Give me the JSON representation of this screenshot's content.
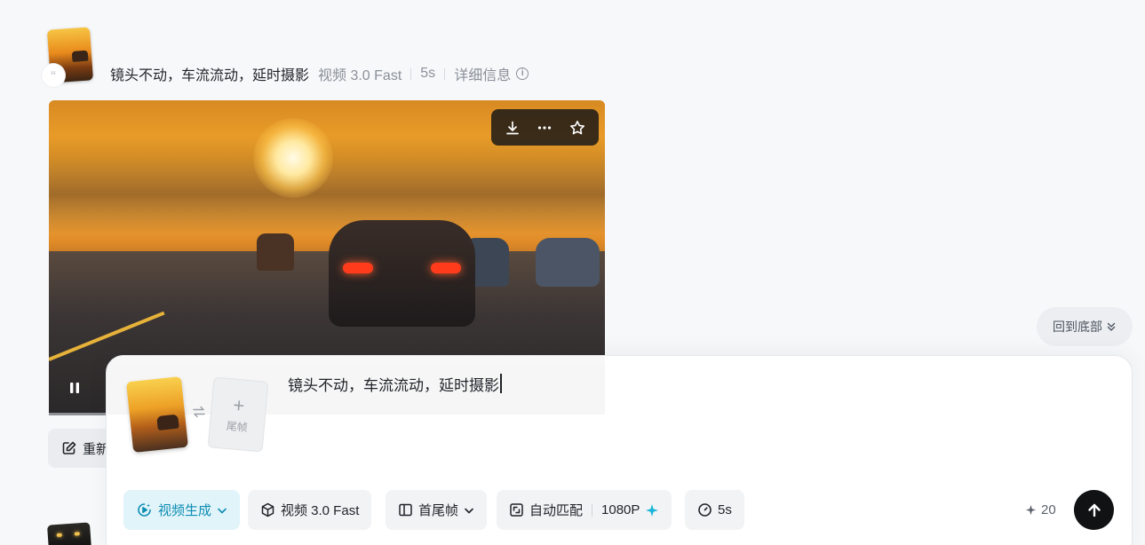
{
  "history_item": {
    "prompt": "镜头不动，车流流动，延时摄影",
    "model": "视频 3.0 Fast",
    "duration": "5s",
    "details_label": "详细信息",
    "regenerate_label": "重新"
  },
  "video_toolbar": {
    "icons": [
      "download-icon",
      "more-icon",
      "star-icon"
    ]
  },
  "back_to_bottom_label": "回到底部",
  "composer": {
    "last_frame_label": "尾帧",
    "input_text": "镜头不动，车流流动，延时摄影",
    "mode_label": "视频生成",
    "model_label": "视频 3.0 Fast",
    "frame_mode_label": "首尾帧",
    "ratio_label": "自动匹配",
    "resolution_label": "1080P",
    "duration_label": "5s",
    "credits": "20",
    "accent_color": "#0e8db3"
  }
}
